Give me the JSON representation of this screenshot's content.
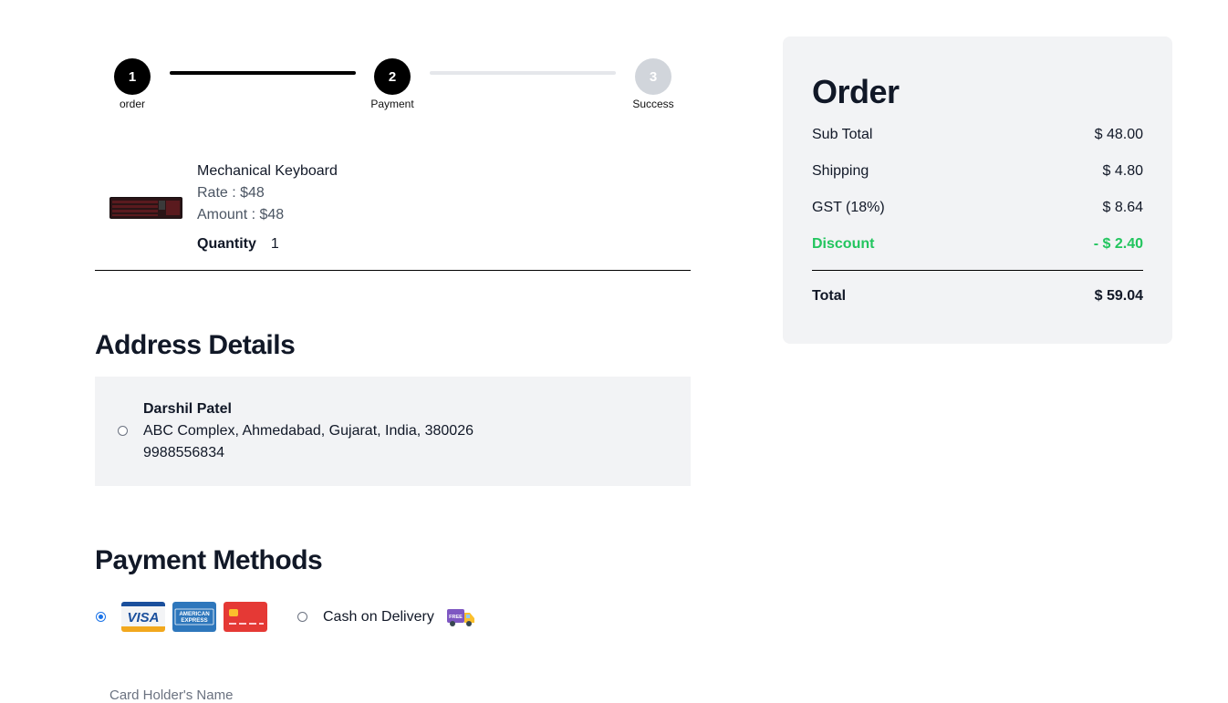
{
  "stepper": {
    "steps": [
      {
        "number": "1",
        "label": "order"
      },
      {
        "number": "2",
        "label": "Payment"
      },
      {
        "number": "3",
        "label": "Success"
      }
    ]
  },
  "cart": {
    "item": {
      "name": "Mechanical Keyboard",
      "rate": "Rate : $48",
      "amount": "Amount : $48",
      "quantity_label": "Quantity",
      "quantity_value": "1"
    }
  },
  "address": {
    "heading": "Address Details",
    "name": "Darshil Patel",
    "line": "ABC Complex, Ahmedabad, Gujarat, India, 380026",
    "phone": "9988556834"
  },
  "payment": {
    "heading": "Payment Methods",
    "card_logos": {
      "visa": "VISA",
      "amex_line1": "AMERICAN",
      "amex_line2": "EXPRESS"
    },
    "cod_label": "Cash on Delivery",
    "cod_badge": "FREE",
    "card_holder_placeholder": "Card Holder's Name"
  },
  "summary": {
    "title": "Order",
    "rows": [
      {
        "label": "Sub Total",
        "value": "$ 48.00"
      },
      {
        "label": "Shipping",
        "value": "$ 4.80"
      },
      {
        "label": "GST (18%)",
        "value": "$ 8.64"
      },
      {
        "label": "Discount",
        "value": "- $ 2.40"
      }
    ],
    "total": {
      "label": "Total",
      "value": "$ 59.04"
    }
  },
  "colors": {
    "accent": "#000000",
    "discount": "#22c55e",
    "panel_bg": "#f2f3f5",
    "radio_selected": "#1a73e8"
  }
}
